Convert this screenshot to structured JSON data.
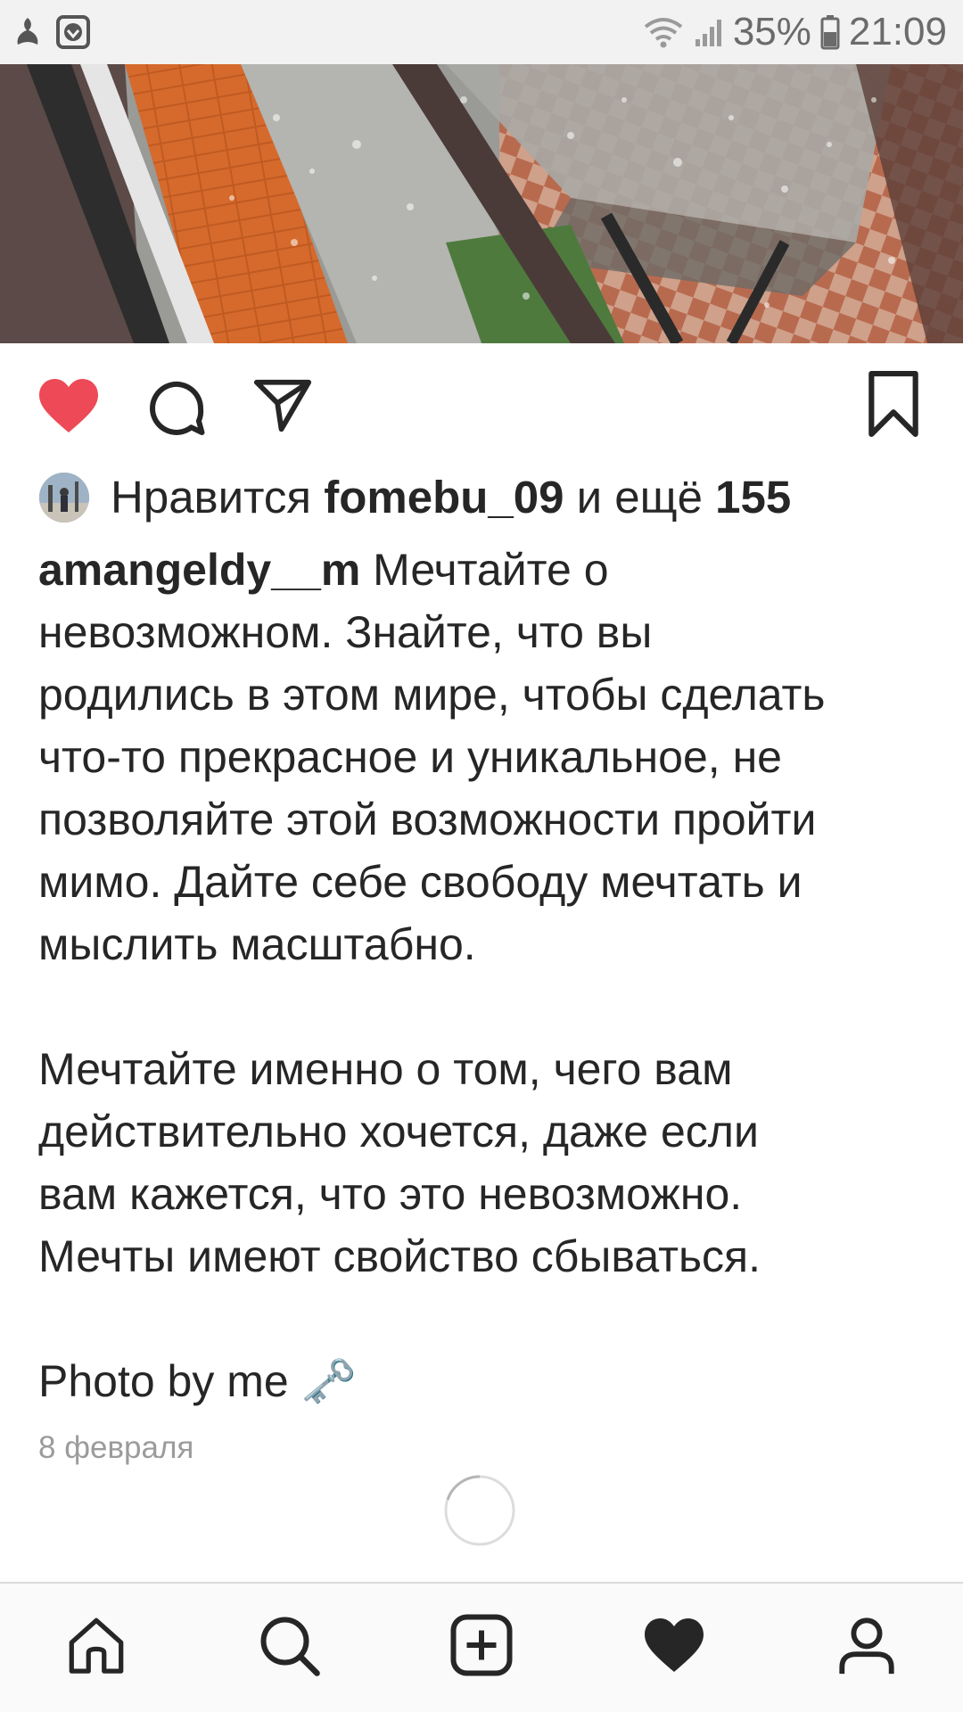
{
  "status_bar": {
    "battery": "35%",
    "time": "21:09"
  },
  "post": {
    "likes": {
      "prefix": "Нравится ",
      "user": "fomebu_09",
      "middle": " и ещё ",
      "count": "155"
    },
    "caption": {
      "author": "amangeldy__m",
      "text": " Мечтайте о\nневозможном. Знайте, что вы\nродились в этом мире, чтобы сделать\nчто-то прекрасное и уникальное, не\nпозволяйте этой возможности пройти\nмимо. Дайте себе свободу мечтать и\nмыслить масштабно.\n\nМечтайте именно о том, чего вам\nдействительно хочется, даже если\nвам кажется, что это невозможно.\nМечты имеют свойство сбываться.\n\nPhoto by me ",
      "emoji": "🗝️"
    },
    "date": "8 февраля",
    "liked": true
  },
  "icons": {
    "like": "heart-icon",
    "comment": "comment-icon",
    "share": "paper-plane-icon",
    "save": "bookmark-icon"
  },
  "bottom_nav": [
    "home-icon",
    "search-icon",
    "new-post-icon",
    "activity-heart-icon",
    "profile-icon"
  ],
  "colors": {
    "like_red": "#ed4956",
    "text": "#262626",
    "muted": "#9b9b9b",
    "status_bg": "#f2f2f2"
  }
}
